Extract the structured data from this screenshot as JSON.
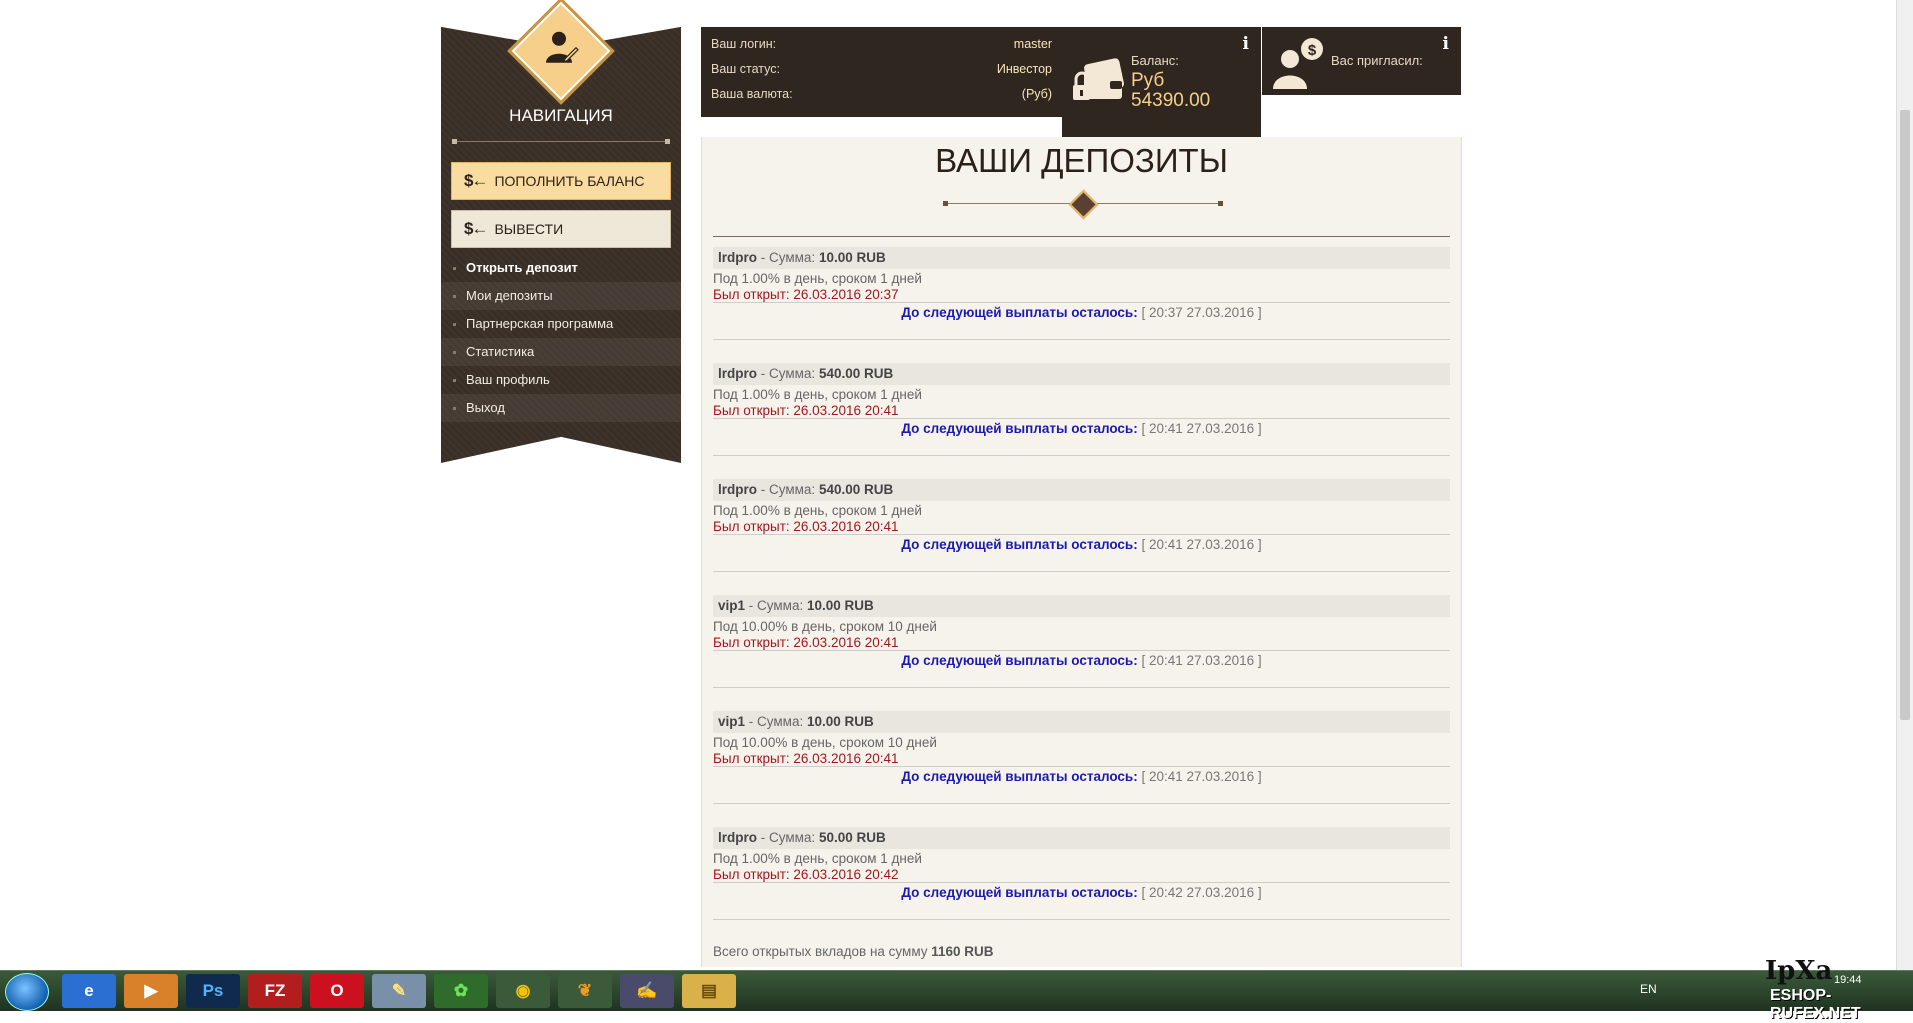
{
  "nav": {
    "title": "НАВИГАЦИЯ",
    "deposit_button": "ПОПОЛНИТЬ БАЛАНС",
    "withdraw_button": "ВЫВЕСТИ",
    "deposit_icon": "$←",
    "withdraw_icon": "$←",
    "items": [
      {
        "label": "Открыть депозит"
      },
      {
        "label": "Мои депозиты"
      },
      {
        "label": "Партнерская программа"
      },
      {
        "label": "Статистика"
      },
      {
        "label": "Ваш профиль"
      },
      {
        "label": "Выход"
      }
    ]
  },
  "account": {
    "login_label": "Ваш логин:",
    "login_value": "master",
    "status_label": "Ваш статус:",
    "status_value": "Инвестор",
    "currency_label": "Ваша валюта:",
    "currency_value": "(Руб)"
  },
  "balance": {
    "label": "Баланс:",
    "currency": "Руб",
    "amount": "54390.00"
  },
  "referral": {
    "label": "Вас пригласил:"
  },
  "info_glyph": "i",
  "page_title": "ВАШИ ДЕПОЗИТЫ",
  "deposits_text": {
    "sum_label": "- Сумма:",
    "opened_label": "Был открыт:",
    "next_label": "До следующей выплаты осталось:"
  },
  "deposits": [
    {
      "plan": "lrdpro",
      "amount": "10.00 RUB",
      "terms": "Под 1.00% в день, сроком 1 дней",
      "opened": "26.03.2016 20:37",
      "next": "[ 20:37 27.03.2016 ]"
    },
    {
      "plan": "lrdpro",
      "amount": "540.00 RUB",
      "terms": "Под 1.00% в день, сроком 1 дней",
      "opened": "26.03.2016 20:41",
      "next": "[ 20:41 27.03.2016 ]"
    },
    {
      "plan": "lrdpro",
      "amount": "540.00 RUB",
      "terms": "Под 1.00% в день, сроком 1 дней",
      "opened": "26.03.2016 20:41",
      "next": "[ 20:41 27.03.2016 ]"
    },
    {
      "plan": "vip1",
      "amount": "10.00 RUB",
      "terms": "Под 10.00% в день, сроком 10 дней",
      "opened": "26.03.2016 20:41",
      "next": "[ 20:41 27.03.2016 ]"
    },
    {
      "plan": "vip1",
      "amount": "10.00 RUB",
      "terms": "Под 10.00% в день, сроком 10 дней",
      "opened": "26.03.2016 20:41",
      "next": "[ 20:41 27.03.2016 ]"
    },
    {
      "plan": "lrdpro",
      "amount": "50.00 RUB",
      "terms": "Под 1.00% в день, сроком 1 дней",
      "opened": "26.03.2016 20:42",
      "next": "[ 20:42 27.03.2016 ]"
    }
  ],
  "total": {
    "label": "Всего открытых вкладов на сумму",
    "value": "1160 RUB"
  },
  "taskbar": {
    "apps": [
      {
        "icon": "internet-explorer-icon",
        "glyph": "e",
        "bg": "#2a6fd1",
        "fg": "#ffffff"
      },
      {
        "icon": "media-player-icon",
        "glyph": "▶",
        "bg": "#d9802a",
        "fg": "#ffffff"
      },
      {
        "icon": "photoshop-icon",
        "glyph": "Ps",
        "bg": "#0f2a4d",
        "fg": "#4fb3ff"
      },
      {
        "icon": "filezilla-icon",
        "glyph": "FZ",
        "bg": "#b21e1e",
        "fg": "#ffffff"
      },
      {
        "icon": "opera-icon",
        "glyph": "O",
        "bg": "#cc1020",
        "fg": "#ffffff"
      },
      {
        "icon": "paint-icon",
        "glyph": "✎",
        "bg": "#7a8fa8",
        "fg": "#ffe27a"
      },
      {
        "icon": "icq-icon",
        "glyph": "✿",
        "bg": "#2f6b2a",
        "fg": "#6fe05a"
      },
      {
        "icon": "chrome-icon",
        "glyph": "◉",
        "bg": "#3a5a3a",
        "fg": "#f4c20d"
      },
      {
        "icon": "leaf-app-icon",
        "glyph": "❦",
        "bg": "#3a5a3a",
        "fg": "#f39a1e"
      },
      {
        "icon": "pad-editor-icon",
        "glyph": "✍",
        "bg": "#4a4a6a",
        "fg": "#ffffff"
      },
      {
        "icon": "file-explorer-icon",
        "glyph": "▤",
        "bg": "#d9b04a",
        "fg": "#6b4d10"
      }
    ],
    "lang": "EN",
    "clock": "19:44",
    "watermark_a": "IpXa",
    "watermark_b": "ESHOP-RUFEX.NET"
  }
}
